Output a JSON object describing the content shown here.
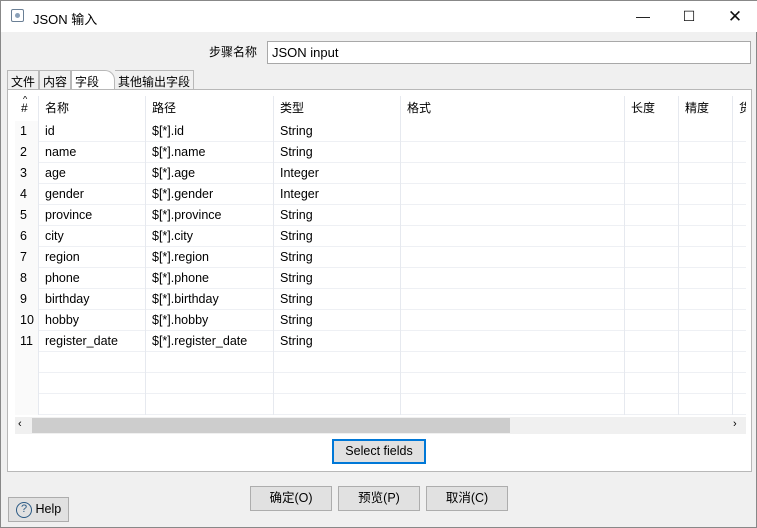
{
  "window": {
    "title": "JSON 输入",
    "icon": "step-icon",
    "controls": [
      "minimize",
      "maximize",
      "close"
    ]
  },
  "step": {
    "label": "步骤名称",
    "value": "JSON input"
  },
  "tabs": [
    {
      "label": "文件"
    },
    {
      "label": "内容"
    },
    {
      "label": "字段",
      "active": true
    },
    {
      "label": "其他输出字段"
    }
  ],
  "table": {
    "columns": [
      "#",
      "名称",
      "路径",
      "类型",
      "格式",
      "长度",
      "精度",
      "货币类型"
    ],
    "rows": [
      [
        "1",
        "id",
        "$[*].id",
        "String"
      ],
      [
        "2",
        "name",
        "$[*].name",
        "String"
      ],
      [
        "3",
        "age",
        "$[*].age",
        "Integer"
      ],
      [
        "4",
        "gender",
        "$[*].gender",
        "Integer"
      ],
      [
        "5",
        "province",
        "$[*].province",
        "String"
      ],
      [
        "6",
        "city",
        "$[*].city",
        "String"
      ],
      [
        "7",
        "region",
        "$[*].region",
        "String"
      ],
      [
        "8",
        "phone",
        "$[*].phone",
        "String"
      ],
      [
        "9",
        "birthday",
        "$[*].birthday",
        "String"
      ],
      [
        "10",
        "hobby",
        "$[*].hobby",
        "String"
      ],
      [
        "11",
        "register_date",
        "$[*].register_date",
        "String"
      ]
    ]
  },
  "buttons": {
    "select_fields": "Select fields",
    "ok": "确定(O)",
    "preview": "预览(P)",
    "cancel": "取消(C)",
    "help": "Help"
  },
  "colors": {
    "focus_border": "#0078d7"
  }
}
